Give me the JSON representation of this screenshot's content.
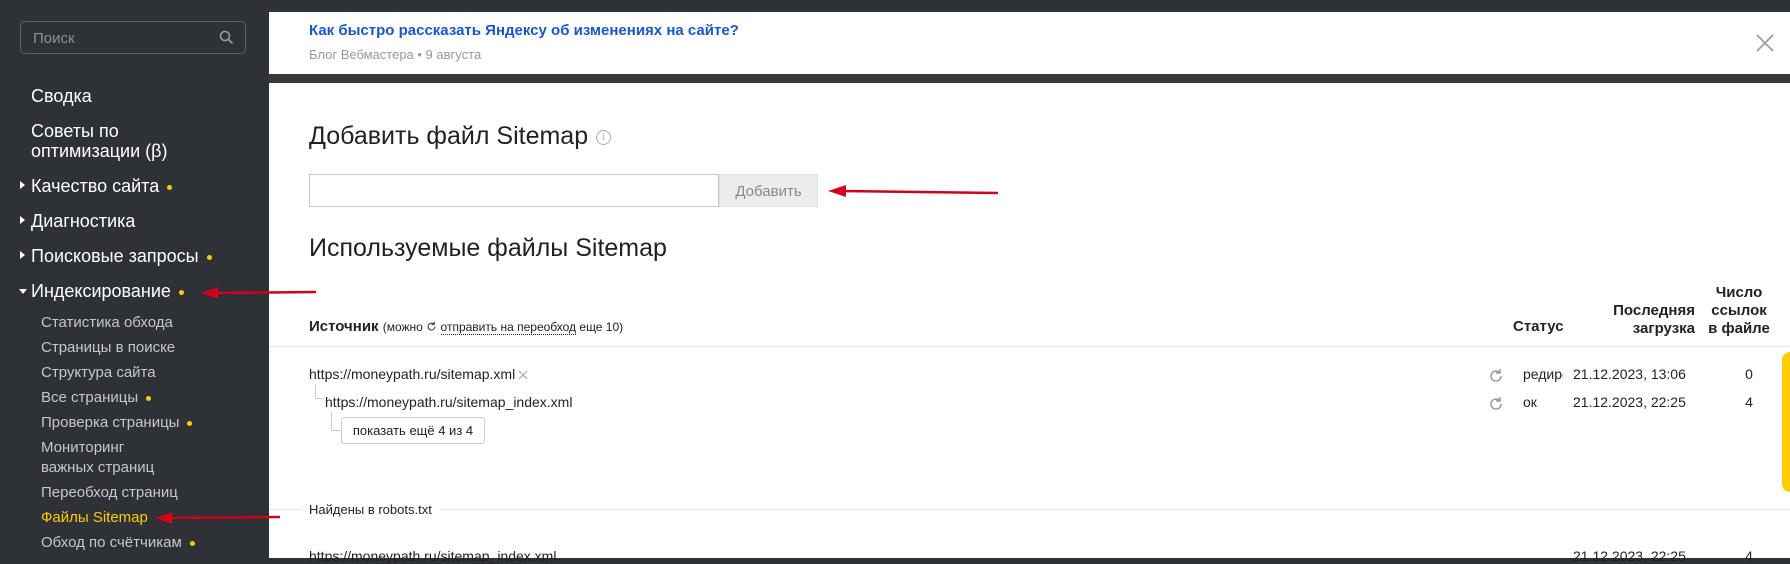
{
  "search": {
    "placeholder": "Поиск"
  },
  "nav": {
    "summary": "Сводка",
    "tips_line1": "Советы по",
    "tips_line2": "оптимизации (β)",
    "quality": "Качество сайта",
    "diagnostics": "Диагностика",
    "queries": "Поисковые запросы",
    "indexing": "Индексирование",
    "sub": [
      {
        "label": "Статистика обхода"
      },
      {
        "label": "Страницы в поиске"
      },
      {
        "label": "Структура сайта"
      },
      {
        "label": "Все страницы"
      },
      {
        "label": "Проверка страницы"
      },
      {
        "label": "Мониторинг"
      },
      {
        "label": "важных страниц"
      },
      {
        "label": "Переобход страниц"
      },
      {
        "label": "Файлы Sitemap"
      },
      {
        "label": "Обход по счётчикам"
      }
    ]
  },
  "banner": {
    "title": "Как быстро рассказать Яндексу об изменениях на сайте?",
    "meta": "Блог Вебмастера • 9 августа"
  },
  "add": {
    "title": "Добавить файл Sitemap",
    "info_glyph": "i",
    "button": "Добавить"
  },
  "used": {
    "title": "Используемые файлы Sitemap"
  },
  "table": {
    "source": "Источник",
    "source_note_prefix": "(можно",
    "source_note_link": "отправить на переобход",
    "source_note_suffix": "еще 10)",
    "status": "Статус",
    "last_1": "Последняя",
    "last_2": "загрузка",
    "count_1": "Число",
    "count_2": "ссылок",
    "count_3": "в файле",
    "rows": [
      {
        "url": "https://moneypath.ru/sitemap.xml",
        "status": "редирект",
        "date": "21.12.2023, 13:06",
        "count": "0"
      },
      {
        "url": "https://moneypath.ru/sitemap_index.xml",
        "status": "ок",
        "date": "21.12.2023, 22:25",
        "count": "4"
      }
    ],
    "show_more": "показать ещё 4 из 4",
    "robots": "Найдены в robots.txt",
    "robots_row": {
      "url": "https://moneypath.ru/sitemap_index.xml",
      "date": "21.12.2023, 22:25",
      "count": "4"
    }
  },
  "colors": {
    "accent": "#ffcc00",
    "link": "#1a56c6",
    "annotation": "#d0021b"
  }
}
